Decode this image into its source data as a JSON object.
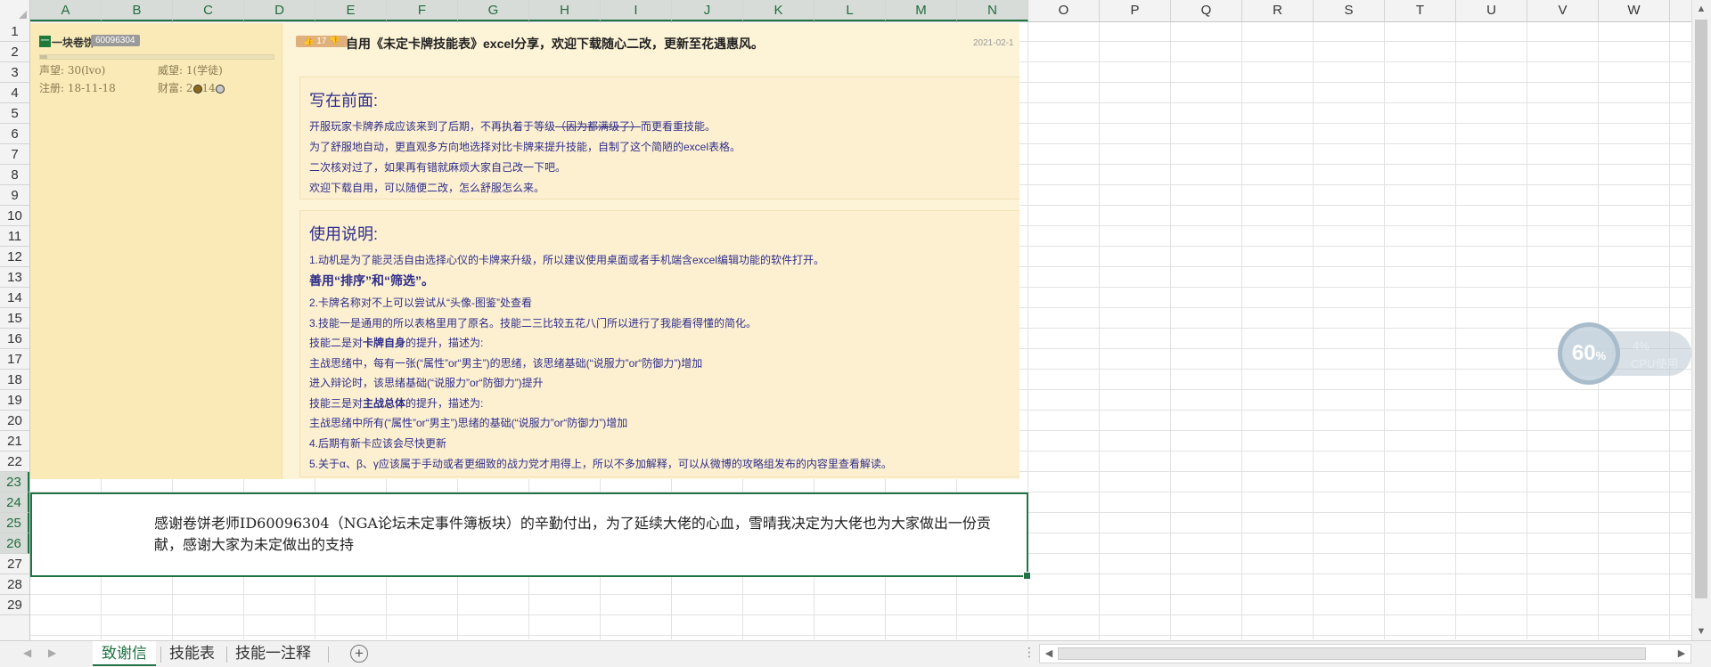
{
  "columns": [
    "A",
    "B",
    "C",
    "D",
    "E",
    "F",
    "G",
    "H",
    "I",
    "J",
    "K",
    "L",
    "M",
    "N",
    "O",
    "P",
    "Q",
    "R",
    "S",
    "T",
    "U",
    "V",
    "W"
  ],
  "rows": [
    "1",
    "2",
    "3",
    "4",
    "5",
    "6",
    "7",
    "8",
    "9",
    "10",
    "11",
    "12",
    "13",
    "14",
    "15",
    "16",
    "17",
    "18",
    "19",
    "20",
    "21",
    "22",
    "23",
    "24",
    "25",
    "26",
    "27",
    "28",
    "29"
  ],
  "post": {
    "username": "一块卷饼",
    "uid": "60096304",
    "prestige_label": "声望: 30(lvo)",
    "rank_label": "威望: 1(学徒)",
    "register_label": "注册: 18-11-18",
    "wealth_label": "财富: 2",
    "wealth_tail": "14",
    "like_count": "17",
    "title": "自用《未定卡牌技能表》excel分享，欢迎下载随心二改，更新至花遇惠风。",
    "date": "2021-02-1",
    "section1": {
      "heading": "写在前面:",
      "line1_a": "开服玩家卡牌养成应该来到了后期，不再执着于等级",
      "line1_strike": "（因为都满级了）",
      "line1_b": "而更看重技能。",
      "line2": "为了舒服地自动，更直观多方向地选择对比卡牌来提升技能，自制了这个简陋的excel表格。",
      "line3": "二次核对过了，如果再有错就麻烦大家自己改一下吧。",
      "line4": "欢迎下载自用，可以随便二改，怎么舒服怎么来。"
    },
    "section2": {
      "heading": "使用说明:",
      "l1": "1.动机是为了能灵活自由选择心仪的卡牌来升级，所以建议使用桌面或者手机端含excel编辑功能的软件打开。",
      "l2": "善用“排序”和“筛选”。",
      "l3": "2.卡牌名称对不上可以尝试从“头像-图鉴”处查看",
      "l4": "3.技能一是通用的所以表格里用了原名。技能二三比较五花八门所以进行了我能看得懂的简化。",
      "l5_a": "技能二是对",
      "l5_b": "卡牌自身",
      "l5_c": "的提升，描述为:",
      "l6": "主战思绪中，每有一张(“属性”or“男主”)的思绪，该思绪基础(“说服力”or“防御力”)增加",
      "l7": "进入辩论时，该思绪基础(“说服力”or“防御力”)提升",
      "l8_a": "技能三是对",
      "l8_b": "主战总体",
      "l8_c": "的提升，描述为:",
      "l9": "主战思绪中所有(“属性”or“男主”)思绪的基础(“说服力”or“防御力”)增加",
      "l10": "4.后期有新卡应该会尽快更新",
      "l11": "5.关于α、β、γ应该属于手动或者更细致的战力党才用得上，所以不多加解释，可以从微博的攻略组发布的内容里查看解读。"
    }
  },
  "note": {
    "text": "感谢卷饼老师ID60096304（NGA论坛未定事件簿板块）的辛勤付出，为了延续大佬的心血，雪晴我决定为大佬也为大家做出一份贡献，感谢大家为未定做出的支持"
  },
  "cpu": {
    "value": "60",
    "unit": "%",
    "side_pct": "4%",
    "label": "CPU使用"
  },
  "tabs": {
    "t1": "致谢信",
    "t2": "技能表",
    "t3": "技能一注释",
    "active": "致谢信"
  }
}
